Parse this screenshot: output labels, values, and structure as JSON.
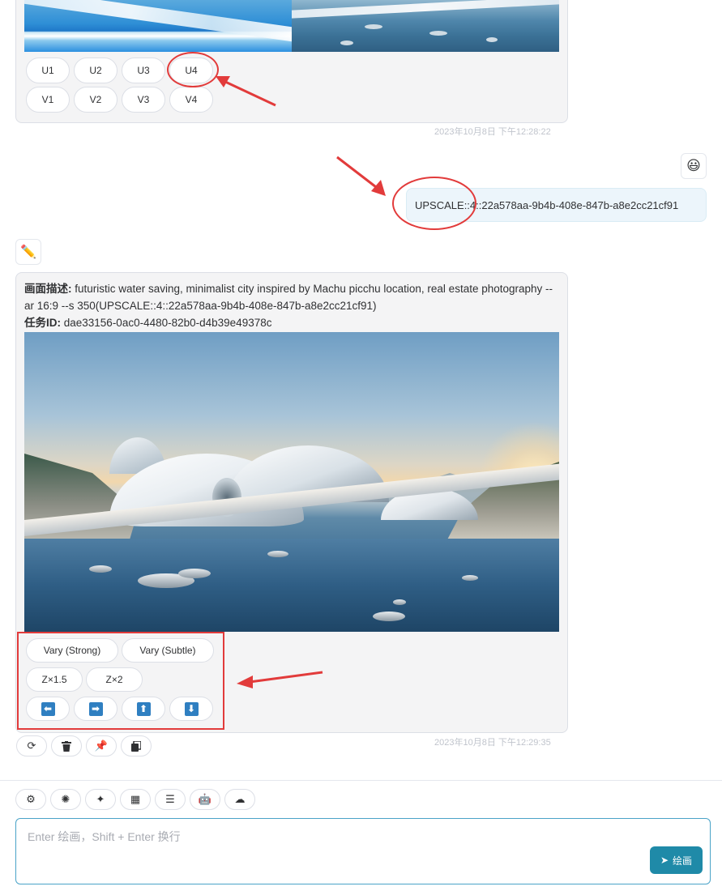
{
  "top_message": {
    "buttons_row1": [
      "U1",
      "U2",
      "U3",
      "U4"
    ],
    "buttons_row2": [
      "V1",
      "V2",
      "V3",
      "V4"
    ],
    "timestamp": "2023年10月8日 下午12:28:22"
  },
  "user_message": {
    "text": "UPSCALE::4::22a578aa-9b4b-408e-847b-a8e2cc21cf91",
    "avatar_icon": "grinning-face-emoji"
  },
  "bot_message": {
    "avatar_icon": "pencil-icon",
    "desc_label": "画面描述:",
    "desc_text": " futuristic water saving, minimalist city inspired by Machu picchu location, real estate photography --ar 16:9 --s 350(UPSCALE::4::22a578aa-9b4b-408e-847b-a8e2cc21cf91)",
    "task_label": "任务ID:",
    "task_id": " dae33156-0ac0-4480-82b0-d4b39e49378c",
    "buttons": {
      "vary_strong": "Vary (Strong)",
      "vary_subtle": "Vary (Subtle)",
      "zoom_1_5": "Z×1.5",
      "zoom_2": "Z×2"
    },
    "pan_icons": [
      "arrow-left-icon",
      "arrow-right-icon",
      "arrow-up-icon",
      "arrow-down-icon"
    ],
    "timestamp": "2023年10月8日 下午12:29:35",
    "actions": [
      "refresh-icon",
      "trash-icon",
      "pin-icon",
      "copy-icon"
    ]
  },
  "toolbar": [
    "gear-icon",
    "openai-icon",
    "magic-wand-icon",
    "apps-icon",
    "layers-icon",
    "robot-icon",
    "cloud-upload-icon"
  ],
  "input": {
    "placeholder": "Enter 绘画，Shift + Enter 换行",
    "value": ""
  },
  "send_button": {
    "label": "绘画"
  },
  "colors": {
    "accent": "#1f8aa8",
    "annotation_red": "#e23b3b",
    "user_bubble": "#ecf5fb"
  }
}
